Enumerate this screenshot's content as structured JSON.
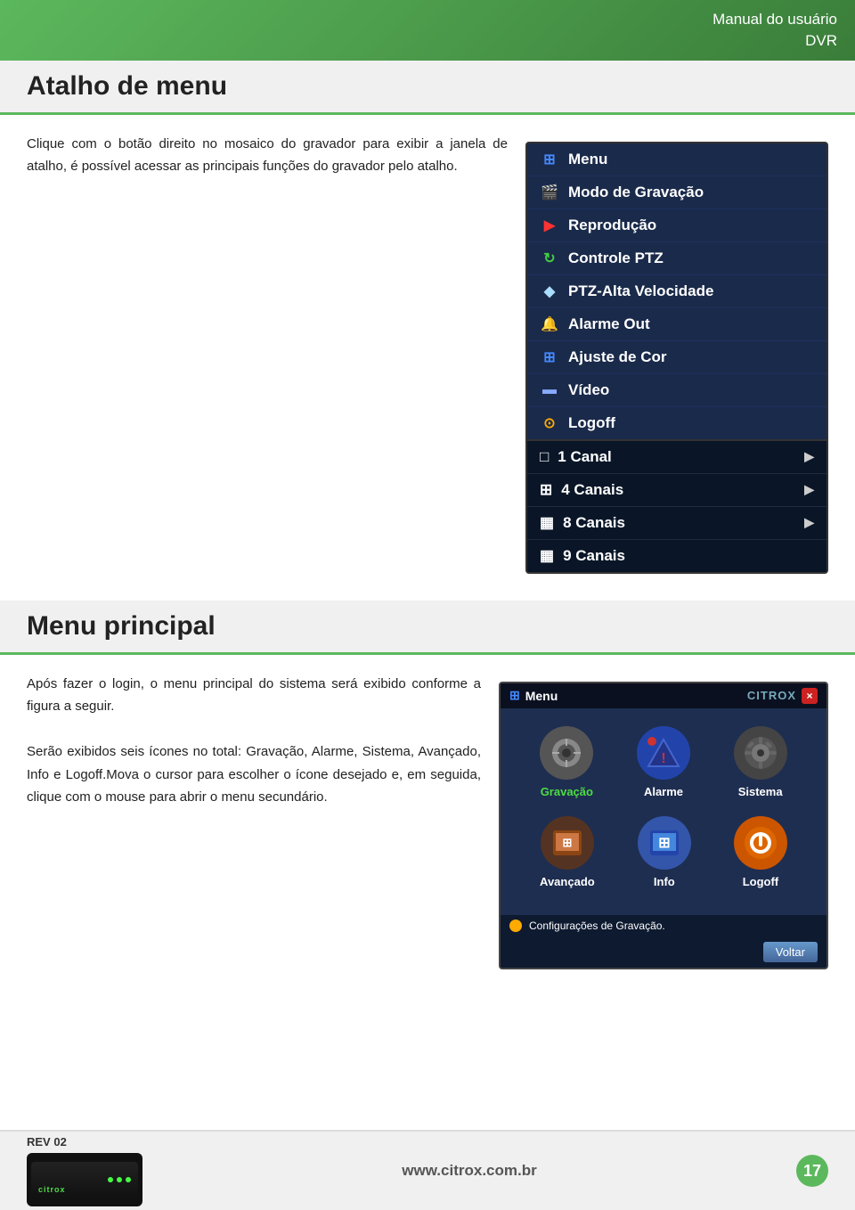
{
  "header": {
    "title_line1": "Manual do usuário",
    "title_line2": "DVR"
  },
  "section1": {
    "title": "Atalho de menu",
    "text": "Clique com o botão direito no mosaico do gravador para exibir a janela de atalho, é possível acessar as principais funções do gravador pelo atalho.",
    "dvr_menu": {
      "top_items": [
        {
          "label": "Menu",
          "icon": "⊞",
          "icon_class": "icon-menu"
        },
        {
          "label": "Modo de Gravação",
          "icon": "🎬",
          "icon_class": "icon-record"
        },
        {
          "label": "Reprodução",
          "icon": "▶",
          "icon_class": "icon-play"
        },
        {
          "label": "Controle PTZ",
          "icon": "🔄",
          "icon_class": "icon-ptz"
        },
        {
          "label": "PTZ-Alta Velocidade",
          "icon": "◆",
          "icon_class": "icon-ptz2"
        },
        {
          "label": "Alarme Out",
          "icon": "🔔",
          "icon_class": "icon-alarm"
        },
        {
          "label": "Ajuste de Cor",
          "icon": "⊞",
          "icon_class": "icon-color"
        },
        {
          "label": "Vídeo",
          "icon": "▬",
          "icon_class": "icon-video"
        },
        {
          "label": "Logoff",
          "icon": "⊙",
          "icon_class": "icon-logoff"
        }
      ],
      "bottom_items": [
        {
          "label": "1 Canal",
          "icon": "□",
          "has_arrow": true
        },
        {
          "label": "4 Canais",
          "icon": "⊞",
          "has_arrow": true
        },
        {
          "label": "8 Canais",
          "icon": "▦",
          "has_arrow": true
        },
        {
          "label": "9 Canais",
          "icon": "▦",
          "has_arrow": false
        }
      ]
    }
  },
  "section2": {
    "title": "Menu principal",
    "text1": "Após fazer o login, o menu principal do sistema será exibido conforme a figura a seguir.",
    "text2": "Serão exibidos seis ícones no total: Gravação, Alarme, Sistema, Avançado, Info e Logoff.Mova o cursor para escolher o ícone desejado e, em seguida, clique com o mouse para abrir o menu secundário.",
    "main_menu": {
      "titlebar_label": "Menu",
      "brand": "CITROX",
      "close": "×",
      "icons_row1": [
        {
          "label": "Gravação",
          "label_color": "green"
        },
        {
          "label": "Alarme",
          "label_color": "white"
        },
        {
          "label": "Sistema",
          "label_color": "white"
        }
      ],
      "icons_row2": [
        {
          "label": "Avançado",
          "label_color": "white"
        },
        {
          "label": "Info",
          "label_color": "white"
        },
        {
          "label": "Logoff",
          "label_color": "white"
        }
      ],
      "status_text": "Configurações de Gravação.",
      "voltar_label": "Voltar"
    }
  },
  "footer": {
    "rev_label": "REV 02",
    "website": "www.citrox.com.br",
    "page_number": "17",
    "brand": "citrox"
  }
}
